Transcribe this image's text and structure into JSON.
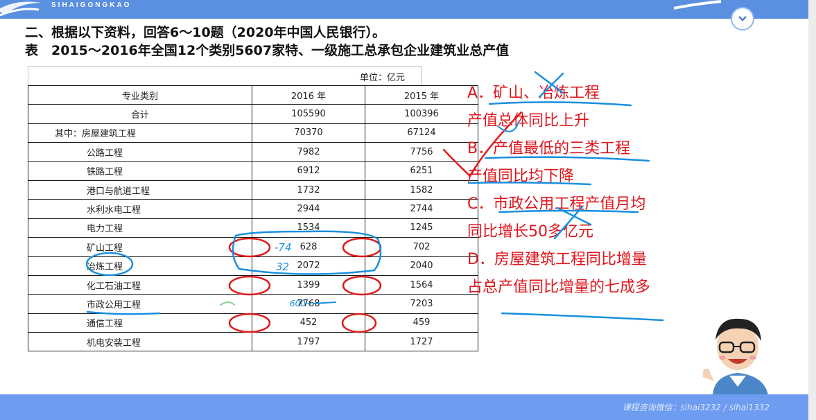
{
  "header": {
    "brand": "SIHAIGONGKAO"
  },
  "question": {
    "title": "二、根据以下资料，回答6～10题（2020年中国人民银行）。",
    "table_caption": "表　2015～2016年全国12个类别5607家特、一级施工总承包企业建筑业总产值"
  },
  "table": {
    "unit": "单位：亿元",
    "columns": [
      "专业类别",
      "2016 年",
      "2015 年"
    ],
    "rows": [
      {
        "name": "合计",
        "v2016": "105590",
        "v2015": "100396"
      },
      {
        "name": "其中：房屋建筑工程",
        "v2016": "70370",
        "v2015": "67124"
      },
      {
        "name": "公路工程",
        "v2016": "7982",
        "v2015": "7756"
      },
      {
        "name": "铁路工程",
        "v2016": "6912",
        "v2015": "6251"
      },
      {
        "name": "港口与航道工程",
        "v2016": "1732",
        "v2015": "1582"
      },
      {
        "name": "水利水电工程",
        "v2016": "2944",
        "v2015": "2744"
      },
      {
        "name": "电力工程",
        "v2016": "1534",
        "v2015": "1245"
      },
      {
        "name": "矿山工程",
        "v2016": "628",
        "v2015": "702"
      },
      {
        "name": "冶炼工程",
        "v2016": "2072",
        "v2015": "2040"
      },
      {
        "name": "化工石油工程",
        "v2016": "1399",
        "v2015": "1564"
      },
      {
        "name": "市政公用工程",
        "v2016": "7768",
        "v2015": "7203"
      },
      {
        "name": "通信工程",
        "v2016": "452",
        "v2015": "459"
      },
      {
        "name": "机电安装工程",
        "v2016": "1797",
        "v2015": "1727"
      }
    ]
  },
  "options": [
    "A．矿山、冶炼工程",
    "产值总体同比上升",
    "B．产值最低的三类工程",
    "产值同比均下降",
    "C．市政公用工程产值月均",
    "同比增长50多亿元",
    "D．房屋建筑工程同比增量",
    "占总产值同比增量的七成多"
  ],
  "annotations": {
    "note_74": "-74",
    "note_32": "32",
    "note_600": "600+"
  },
  "footer": {
    "contact": "课程咨询微信：sihai3232 / sihai1332"
  },
  "colors": {
    "topbar": "#5b8fe0",
    "bottombar": "#6d9cf0",
    "option_text": "#e0141b",
    "blue_ink": "#1a8fe0",
    "red_ink": "#e01a1a"
  },
  "icons": [
    "logo-swoosh-icon",
    "chevron-down-icon",
    "teacher-avatar-icon"
  ]
}
